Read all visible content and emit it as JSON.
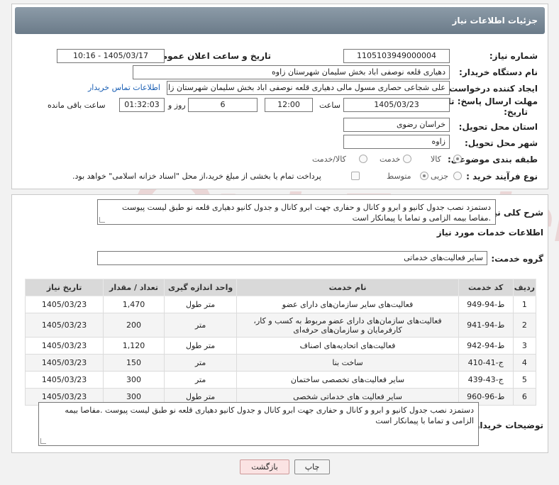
{
  "header": {
    "title": "جزئیات اطلاعات نیاز"
  },
  "form": {
    "need_number_label": "شماره نیاز:",
    "need_number": "1105103949000004",
    "announce_label": "تاریخ و ساعت اعلان عمومی:",
    "announce_value": "1405/03/17 - 10:16",
    "buyer_org_label": "نام دستگاه خریدار:",
    "buyer_org": "دهیاری قلعه نوصفی اباد بخش سلیمان شهرستان زاوه",
    "creator_label": "ایجاد کننده درخواست:",
    "creator": "علی شجاعی حصاری مسول مالی دهیاری قلعه نوصفی اباد بخش سلیمان شهرستان زاوه",
    "contact_link": "اطلاعات تماس خریدار",
    "deadline_label_1": "مهلت ارسال پاسخ: تا",
    "deadline_label_2": "تاریخ:",
    "deadline_date": "1405/03/23",
    "time_label": "ساعت",
    "deadline_time": "12:00",
    "days_value": "6",
    "days_label": "روز و",
    "remaining_time": "01:32:03",
    "remaining_label": "ساعت باقی مانده",
    "province_label": "استان محل تحویل:",
    "province": "خراسان رضوی",
    "city_label": "شهر محل تحویل:",
    "city": "زاوه",
    "category_label": "طبقه بندی موضوعی:",
    "category_options": [
      "کالا",
      "خدمت",
      "کالا/خدمت"
    ],
    "process_label": "نوع فرآیند خرید :",
    "process_options": [
      "جزیی",
      "متوسط"
    ],
    "payment_note": "پرداخت تمام یا بخشی از مبلغ خرید،از محل \"اسناد خزانه اسلامی\" خواهد بود."
  },
  "details": {
    "summary_label": "شرح کلی نیاز:",
    "summary": "دستمزد نصب جدول کانیو و ابرو و کانال و حفاری جهت ابرو کانال و جدول کانیو دهیاری قلعه نو طبق لیست پیوست .مفاصا بیمه الزامی و تماما با پیمانکار است",
    "services_heading": "اطلاعات خدمات مورد نیاز",
    "service_group_label": "گروه خدمت:",
    "service_group": "سایر فعالیت‌های خدماتی",
    "columns": [
      "ردیف",
      "کد خدمت",
      "نام خدمت",
      "واحد اندازه گیری",
      "تعداد / مقدار",
      "تاریخ نیاز"
    ],
    "rows": [
      [
        "1",
        "ط-94-949",
        "فعالیت‌های سایر سازمان‌های دارای عضو",
        "متر طول",
        "1,470",
        "1405/03/23"
      ],
      [
        "2",
        "ط-94-941",
        "فعالیت‌های سازمان‌های دارای عضو مربوط به کسب و کار، کارفرمایان و سازمان‌های حرفه‌ای",
        "متر",
        "200",
        "1405/03/23"
      ],
      [
        "3",
        "ط-94-942",
        "فعالیت‌های اتحادیه‌های اصناف",
        "متر طول",
        "1,120",
        "1405/03/23"
      ],
      [
        "4",
        "ج-41-410",
        "ساخت بنا",
        "متر",
        "150",
        "1405/03/23"
      ],
      [
        "5",
        "ج-43-439",
        "سایر فعالیت‌های تخصصی ساختمان",
        "متر",
        "300",
        "1405/03/23"
      ],
      [
        "6",
        "ط-96-960",
        "سایر فعالیت های خدماتی شخصی",
        "متر طول",
        "300",
        "1405/03/23"
      ]
    ],
    "buyer_notes_label": "توضیحات خریدار:",
    "buyer_notes": "دستمزد نصب جدول کانیو و ابرو و کانال و حفاری جهت ابرو کانال و جدول کانیو دهیاری قلعه نو طبق لیست پیوست .مفاصا بیمه الزامی و تماما با پیمانکار است"
  },
  "buttons": {
    "print": "چاپ",
    "back": "بازگشت"
  },
  "watermark": {
    "text": "AriaTender.net"
  }
}
